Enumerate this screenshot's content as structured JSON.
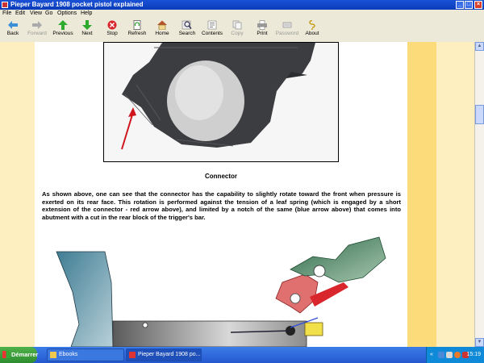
{
  "window": {
    "title": "Pieper Bayard 1908 pocket pistol explained"
  },
  "menu": [
    "File",
    "Edit",
    "View",
    "Go",
    "Options",
    "Help"
  ],
  "toolbar": [
    {
      "label": "Back",
      "icon": "back-arrow-icon",
      "enabled": true
    },
    {
      "label": "Forward",
      "icon": "forward-arrow-icon",
      "enabled": false
    },
    {
      "label": "Previous",
      "icon": "up-arrow-icon",
      "enabled": true
    },
    {
      "label": "Next",
      "icon": "down-arrow-icon",
      "enabled": true
    },
    {
      "label": "Stop",
      "icon": "stop-icon",
      "enabled": true
    },
    {
      "label": "Refresh",
      "icon": "refresh-icon",
      "enabled": true
    },
    {
      "label": "Home",
      "icon": "home-icon",
      "enabled": true
    },
    {
      "label": "Search",
      "icon": "search-icon",
      "enabled": true
    },
    {
      "label": "Contents",
      "icon": "contents-icon",
      "enabled": true
    },
    {
      "label": "Copy",
      "icon": "copy-icon",
      "enabled": false
    },
    {
      "label": "Print",
      "icon": "print-icon",
      "enabled": true
    },
    {
      "label": "Password",
      "icon": "password-icon",
      "enabled": false
    },
    {
      "label": "About",
      "icon": "about-icon",
      "enabled": true
    }
  ],
  "content": {
    "caption": "Connector",
    "paragraph": "As shown above, one can see that the connector has the capability to slightly rotate toward the front when pressure is exerted on its rear face. This rotation is performed against the tension of a leaf spring (which is engaged by a short extension of the connector - red arrow above), and limited by a notch of the same (blue arrow above) that comes into abutment with a cut in the rear block of the trigger's bar."
  },
  "taskbar": {
    "start_label": "Démarrer",
    "tasks": [
      {
        "label": "Ebooks",
        "active": false
      },
      {
        "label": "Pieper Bayard 1908 po...",
        "active": true
      }
    ],
    "tray_chevron": "«",
    "clock": "15:19"
  }
}
